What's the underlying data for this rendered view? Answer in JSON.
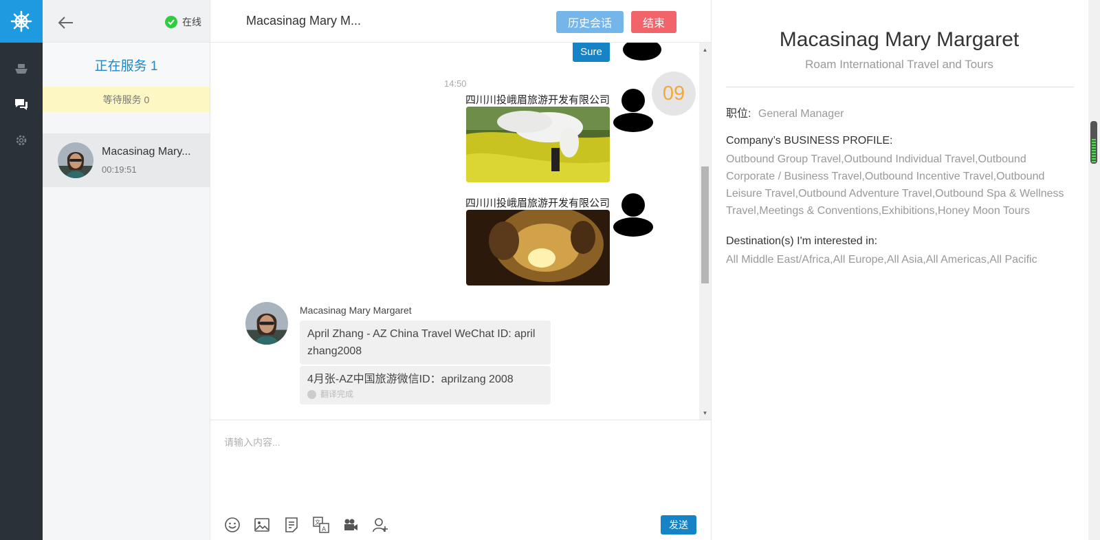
{
  "nav": {
    "status_label": "在线",
    "serving_label": "正在服务 1",
    "waiting_label": "等待服务 0"
  },
  "session": {
    "name": "Macasinag Mary...",
    "duration": "00:19:51"
  },
  "chat": {
    "title": "Macasinag Mary M...",
    "history_button": "历史会话",
    "end_button": "结束",
    "sure_button": "Sure",
    "timestamp": "14:50",
    "badge": "09",
    "outgoing": [
      {
        "sender": "四川川投峨眉旅游开发有限公司"
      },
      {
        "sender": "四川川投峨眉旅游开发有限公司"
      }
    ],
    "incoming": {
      "name": "Macasinag Mary Margaret",
      "original": "April Zhang - AZ China Travel WeChat ID: april zhang2008",
      "translation": "4月张-AZ中国旅游微信ID：aprilzang 2008",
      "translated_tag": "翻译完成"
    },
    "input_placeholder": "请输入内容...",
    "send_button": "发送"
  },
  "profile": {
    "name": "Macasinag Mary Margaret",
    "company": "Roam International Travel and Tours",
    "position_label": "职位:",
    "position_value": "General Manager",
    "business_label": "Company’s BUSINESS PROFILE:",
    "business_value": "Outbound Group Travel,Outbound Individual Travel,Outbound Corporate / Business Travel,Outbound Incentive Travel,Outbound Leisure Travel,Outbound Adventure Travel,Outbound Spa & Wellness Travel,Meetings & Conventions,Exhibitions,Honey Moon Tours",
    "destinations_label": "Destination(s) I'm interested in:",
    "destinations_value": "All Middle East/Africa,All Europe,All Asia,All Americas,All Pacific"
  },
  "colors": {
    "accent": "#1683c6",
    "rail": "#2b3138",
    "logo_bg": "#1e9be0",
    "end": "#f1656a",
    "history": "#74b5ea",
    "waiting_bg": "#fdf7c3",
    "badge_text": "#f4a73c"
  },
  "icons": [
    "ship-wheel-icon",
    "boat-icon",
    "chat-bubbles-icon",
    "gear-icon",
    "back-arrow-icon",
    "check-circle-icon",
    "emoji-icon",
    "image-icon",
    "quick-reply-icon",
    "translate-icon",
    "video-icon",
    "add-user-icon"
  ]
}
